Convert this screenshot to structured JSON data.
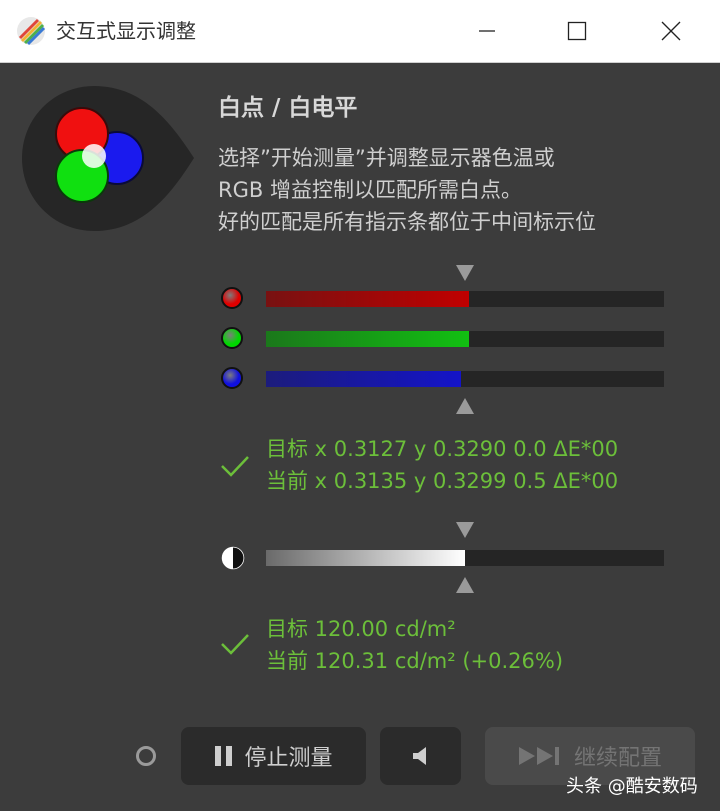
{
  "window": {
    "title": "交互式显示调整",
    "controls": {
      "minimize": "minimize-icon",
      "maximize": "maximize-icon",
      "close": "close-icon"
    }
  },
  "header": {
    "heading": "白点 / 白电平",
    "description_lines": [
      "选择”开始测量”并调整显示器色温或",
      "RGB 增益控制以匹配所需白点。",
      "好的匹配是所有指示条都位于中间标示位"
    ]
  },
  "rgb_bars": [
    {
      "name": "red",
      "color": "#e00000",
      "fill_color": "#c00000",
      "level": 0.51
    },
    {
      "name": "green",
      "color": "#00d800",
      "fill_color": "#12c012",
      "level": 0.51
    },
    {
      "name": "blue",
      "color": "#1010e0",
      "fill_color": "#1414c8",
      "level": 0.49
    }
  ],
  "white_point": {
    "target": "目标 x 0.3127 y 0.3290 0.0 ΔE*00",
    "current": "当前 x 0.3135 y 0.3299 0.5 ΔE*00"
  },
  "luminance_bar": {
    "level": 0.5
  },
  "luminance": {
    "target": "目标 120.00 cd/m²",
    "current": "当前 120.31 cd/m² (+0.26%)"
  },
  "buttons": {
    "stop": "停止测量",
    "continue": "继续配置"
  },
  "watermark": "头条 @酷安数码",
  "colors": {
    "accent_green": "#6cbf3a",
    "background": "#3c3c3c"
  }
}
